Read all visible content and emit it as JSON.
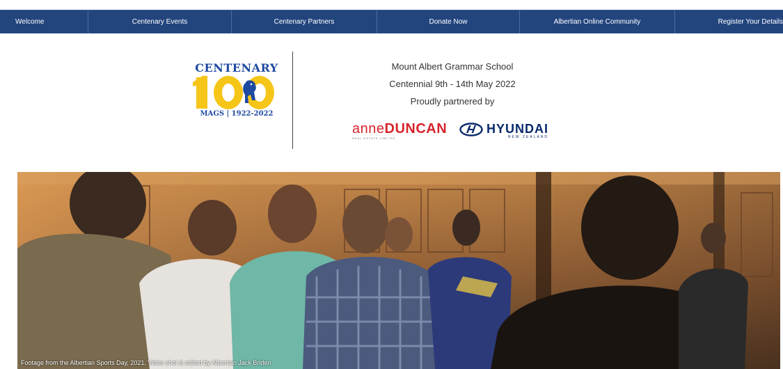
{
  "nav": {
    "items": [
      {
        "label": "Welcome"
      },
      {
        "label": "Centenary Events"
      },
      {
        "label": "Centenary Partners"
      },
      {
        "label": "Donate Now"
      },
      {
        "label": "Albertian Online Community"
      },
      {
        "label": "Register Your Details"
      }
    ]
  },
  "logo": {
    "word": "CENTENARY",
    "number": "100",
    "sub": "MAGS | 1922-2022"
  },
  "info": {
    "line1": "Mount Albert Grammar School",
    "line2": "Centennial 9th - 14th May 2022",
    "line3": "Proudly partnered by"
  },
  "partners": {
    "anne_light": "anne",
    "anne_bold": "DUNCAN",
    "anne_tag": "REAL ESTATE LIMITED",
    "hyundai_main": "HYUNDAI",
    "hyundai_sub": "NEW ZEALAND"
  },
  "video": {
    "caption": "Footage from the Albertian Sports Day, 2021. Video shot & edited by Albertian Jack Briden"
  },
  "colors": {
    "nav_bg": "#23457e",
    "logo_blue": "#1e4aa0",
    "logo_gold": "#f5c518",
    "anne_red": "#d6242c",
    "hyundai_navy": "#0a2a6c"
  }
}
